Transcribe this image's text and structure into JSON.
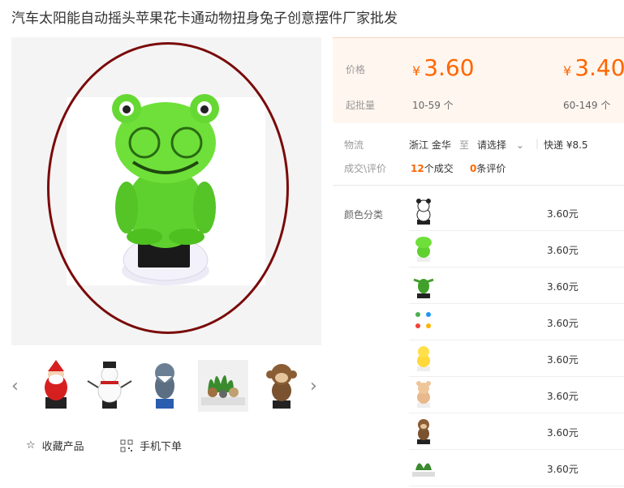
{
  "title": "汽车太阳能自动摇头苹果花卡通动物扭身兔子创意摆件厂家批发",
  "price": {
    "label": "价格",
    "tiers": [
      {
        "currency": "¥",
        "value": "3.60",
        "range": "10-59 个"
      },
      {
        "currency": "¥",
        "value": "3.40",
        "range": "60-149 个"
      }
    ],
    "moq_label": "起批量"
  },
  "logistics": {
    "label": "物流",
    "origin": "浙江 金华",
    "to": "至",
    "select": "请选择",
    "shipping": "快递 ¥8.5"
  },
  "deals": {
    "label": "成交\\评价",
    "count": "12",
    "count_suffix": "个成交",
    "reviews": "0",
    "reviews_suffix": "条评价"
  },
  "color_label": "颜色分类",
  "options": [
    {
      "icon": "panda-icon",
      "price": "3.60元"
    },
    {
      "icon": "frog-icon",
      "price": "3.60元"
    },
    {
      "icon": "plant-icon",
      "price": "3.60元"
    },
    {
      "icon": "mini-set-icon",
      "price": "3.60元"
    },
    {
      "icon": "chick-icon",
      "price": "3.60元"
    },
    {
      "icon": "bear-icon",
      "price": "3.60元"
    },
    {
      "icon": "monkey-icon",
      "price": "3.60元"
    },
    {
      "icon": "group-icon",
      "price": "3.60元"
    }
  ],
  "actions": {
    "favorite": "收藏产品",
    "mobile": "手机下单"
  },
  "colors": {
    "accent": "#ff6600",
    "ring": "#7a0a0a",
    "price_bg": "#fff6ef"
  }
}
